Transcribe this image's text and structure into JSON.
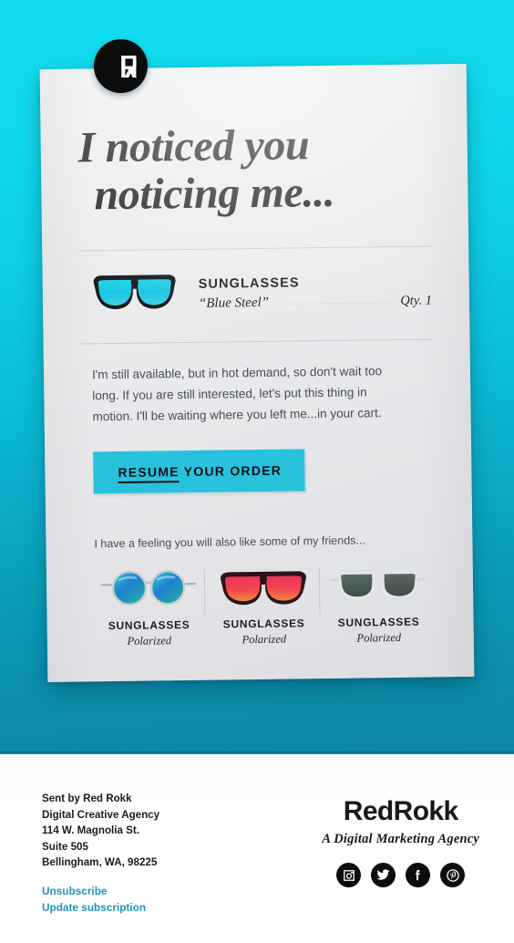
{
  "brand": {
    "logo_icon": "redrokk-monogram-icon",
    "accent_cyan": "#14ddef",
    "accent_deep": "#0c86a4",
    "cta_color": "#29c2dd",
    "link_color": "#2196b5"
  },
  "card": {
    "headline_line1": "I noticed you",
    "headline_line2": "noticing me...",
    "body": "I'm still available, but in hot demand, so don't wait too long. If you are still interested, let's put this thing in motion. I'll be waiting where you left me...in your cart.",
    "product": {
      "image_icon": "sunglasses-blue-wayfarer-icon",
      "title": "SUNGLASSES",
      "name": "“Blue Steel”",
      "qty": "Qty. 1"
    },
    "cta": {
      "underlined": "RESUME",
      "rest": " YOUR ORDER"
    },
    "friends_lead": "I have a feeling you will also like some of my friends...",
    "friends": [
      {
        "image_icon": "sunglasses-round-teal-icon",
        "title": "SUNGLASSES",
        "sub": "Polarized"
      },
      {
        "image_icon": "sunglasses-red-wayfarer-icon",
        "title": "SUNGLASSES",
        "sub": "Polarized"
      },
      {
        "image_icon": "sunglasses-clear-gray-icon",
        "title": "SUNGLASSES",
        "sub": "Polarized"
      }
    ]
  },
  "footer": {
    "address": {
      "line1": "Sent by Red Rokk",
      "line2": "Digital Creative Agency",
      "line3": "114 W. Magnolia St.",
      "line4": "Suite 505",
      "line5": "Bellingham, WA, 98225"
    },
    "unsubscribe": "Unsubscribe",
    "update_subscription": "Update subscription",
    "wordmark": "RedRokk",
    "tagline": "A Digital Marketing Agency",
    "socials": [
      {
        "name": "instagram-icon"
      },
      {
        "name": "twitter-icon"
      },
      {
        "name": "facebook-icon"
      },
      {
        "name": "pinterest-icon"
      }
    ]
  }
}
